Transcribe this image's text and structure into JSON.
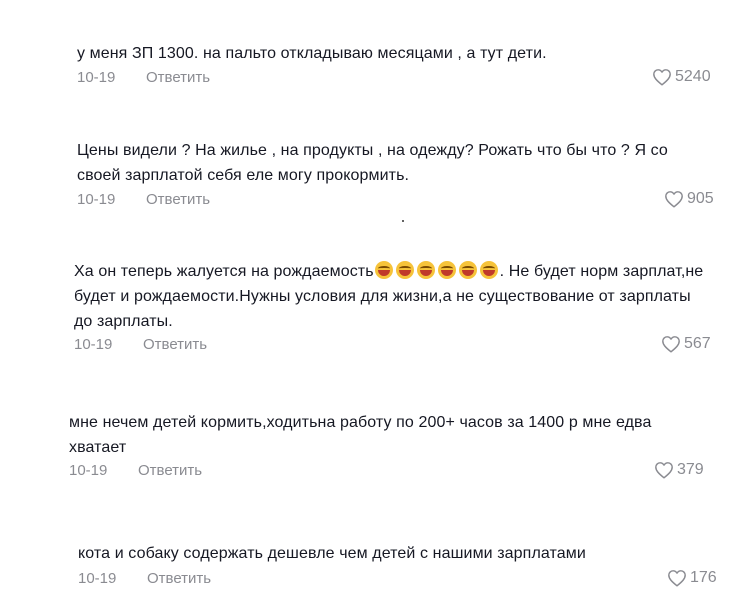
{
  "comments": [
    {
      "text": "у меня ЗП 1300. на пальто откладываю месяцами , а тут дети.",
      "date": "10-19",
      "reply_label": "Ответить",
      "likes": "5240"
    },
    {
      "text_line1": "Цены видели ? На жилье , на продукты , на одежду? Рожать что бы что ? Я со",
      "text_line2": "своей зарплатой себя еле могу прокормить.",
      "date": "10-19",
      "reply_label": "Ответить",
      "likes": "905"
    },
    {
      "text_part1": "Ха он теперь жалуется на рождаемость",
      "emoji": "laughing-crying-emoji",
      "emoji_count": 6,
      "text_part2": ". Не будет норм зарплат,не",
      "text_line2": "будет и рождаемости.Нужны условия для жизни,а не существование от зарплаты",
      "text_line3": "до зарплаты.",
      "date": "10-19",
      "reply_label": "Ответить",
      "likes": "567"
    },
    {
      "text_line1": "мне нечем детей кормить,ходитьна работу по 200+ часов за 1400 р мне едва",
      "text_line2": "хватает",
      "date": "10-19",
      "reply_label": "Ответить",
      "likes": "379"
    },
    {
      "text": "кота и собаку содержать дешевле чем детей с нашими зарплатами",
      "date": "10-19",
      "reply_label": "Ответить",
      "likes": "176"
    }
  ],
  "icons": {
    "like": "heart-outline-icon"
  },
  "colors": {
    "text": "#161823",
    "meta": "#8a8b91",
    "background": "#ffffff"
  }
}
